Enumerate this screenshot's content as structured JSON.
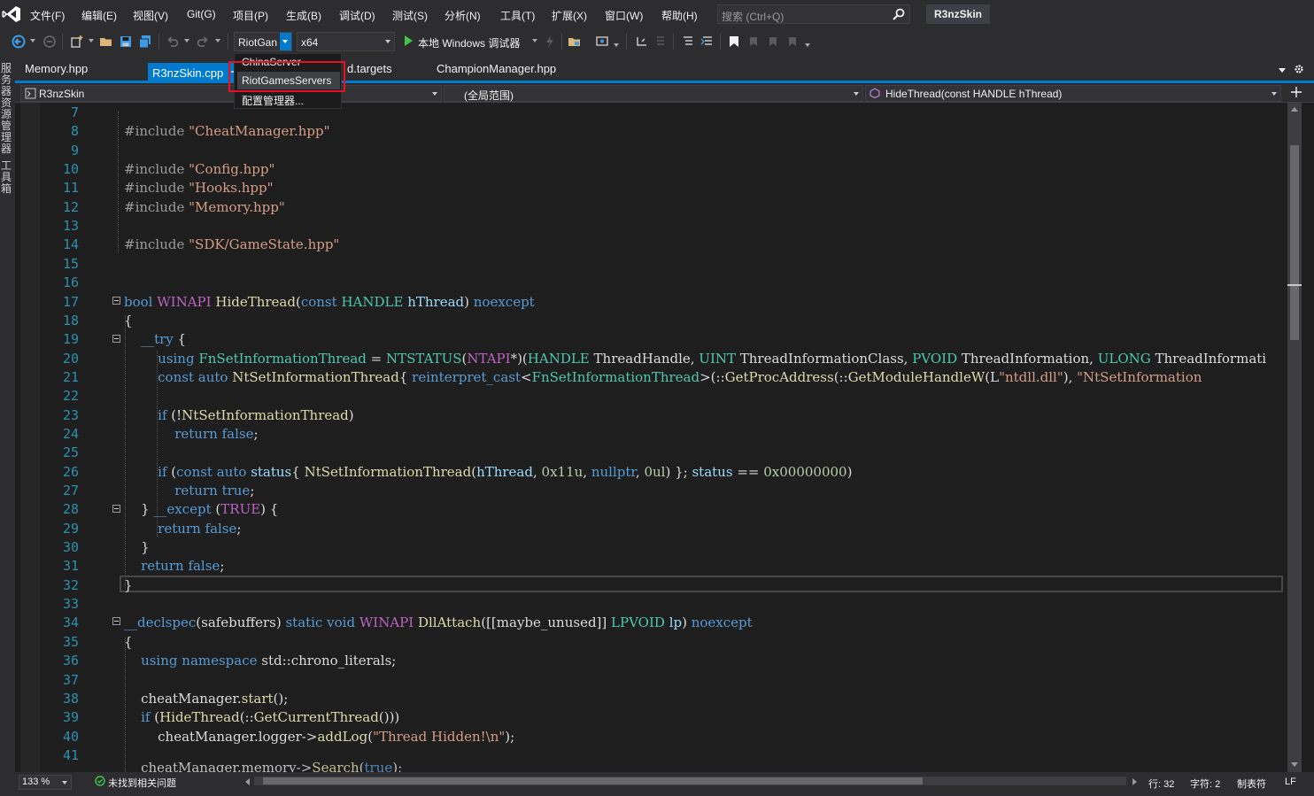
{
  "menu": {
    "items": [
      "文件(F)",
      "编辑(E)",
      "视图(V)",
      "Git(G)",
      "项目(P)",
      "生成(B)",
      "调试(D)",
      "测试(S)",
      "分析(N)",
      "工具(T)",
      "扩展(X)",
      "窗口(W)",
      "帮助(H)"
    ],
    "search_placeholder": "搜索 (Ctrl+Q)",
    "solution_name": "R3nzSkin"
  },
  "toolbar": {
    "configuration": "RiotGan",
    "platform": "x64",
    "start_label": "本地 Windows 调试器"
  },
  "config_dropdown": {
    "items": [
      "ChinaServer",
      "RiotGamesServers",
      "配置管理器..."
    ],
    "highlighted_index": 1
  },
  "side_panel": {
    "tabs": [
      "服务器资源管理器",
      "工具箱"
    ]
  },
  "doc_tabs": {
    "tabs": [
      "Memory.hpp",
      "R3nzSkin.cpp",
      "d.targets",
      "ChampionManager.hpp"
    ],
    "active_index": 1
  },
  "navbar": {
    "project": "R3nzSkin",
    "scope": "(全局范围)",
    "member": "HideThread(const HANDLE hThread)"
  },
  "editor": {
    "line_numbers": [
      "7",
      "8",
      "9",
      "10",
      "11",
      "12",
      "13",
      "14",
      "15",
      "16",
      "17",
      "18",
      "19",
      "20",
      "21",
      "22",
      "23",
      "24",
      "25",
      "26",
      "27",
      "28",
      "29",
      "30",
      "31",
      "32",
      "33",
      "34",
      "35",
      "36",
      "37",
      "38",
      "39",
      "40",
      "41"
    ],
    "lines": [
      "",
      "#include \"CheatManager.hpp\"",
      "",
      "#include \"Config.hpp\"",
      "#include \"Hooks.hpp\"",
      "#include \"Memory.hpp\"",
      "",
      "#include \"SDK/GameState.hpp\"",
      "",
      "",
      "bool WINAPI HideThread(const HANDLE hThread) noexcept",
      "{",
      "    __try {",
      "        using FnSetInformationThread = NTSTATUS(NTAPI*)(HANDLE ThreadHandle, UINT ThreadInformationClass, PVOID ThreadInformation, ULONG ThreadInformati",
      "        const auto NtSetInformationThread{ reinterpret_cast<FnSetInformationThread>(::GetProcAddress(::GetModuleHandleW(L\"ntdll.dll\"), \"NtSetInformation",
      "",
      "        if (!NtSetInformationThread)",
      "            return false;",
      "",
      "        if (const auto status{ NtSetInformationThread(hThread, 0x11u, nullptr, 0ul) }; status == 0x00000000)",
      "            return true;",
      "    } __except (TRUE) {",
      "        return false;",
      "    }",
      "    return false;",
      "}",
      "",
      "__declspec(safebuffers) static void WINAPI DllAttach([[maybe_unused]] LPVOID lp) noexcept",
      "{",
      "    using namespace std::chrono_literals;",
      "",
      "    cheatManager.start();",
      "    if (HideThread(::GetCurrentThread()))",
      "        cheatManager.logger->addLog(\"Thread Hidden!\\n\");",
      ""
    ],
    "partial_line": "    cheatManager.memory->Search(true);"
  },
  "status": {
    "zoom": "133 %",
    "issues": "未找到相关问题",
    "line": "行: 32",
    "col": "字符: 2",
    "indent": "制表符",
    "eol": "LF"
  },
  "colors": {
    "accent": "#007acc",
    "highlight_box": "#e81123",
    "keyword": "#569cd6",
    "string": "#d69d85",
    "type": "#4ec9b0",
    "function": "#dcdcaa",
    "line_number": "#2b91af"
  }
}
